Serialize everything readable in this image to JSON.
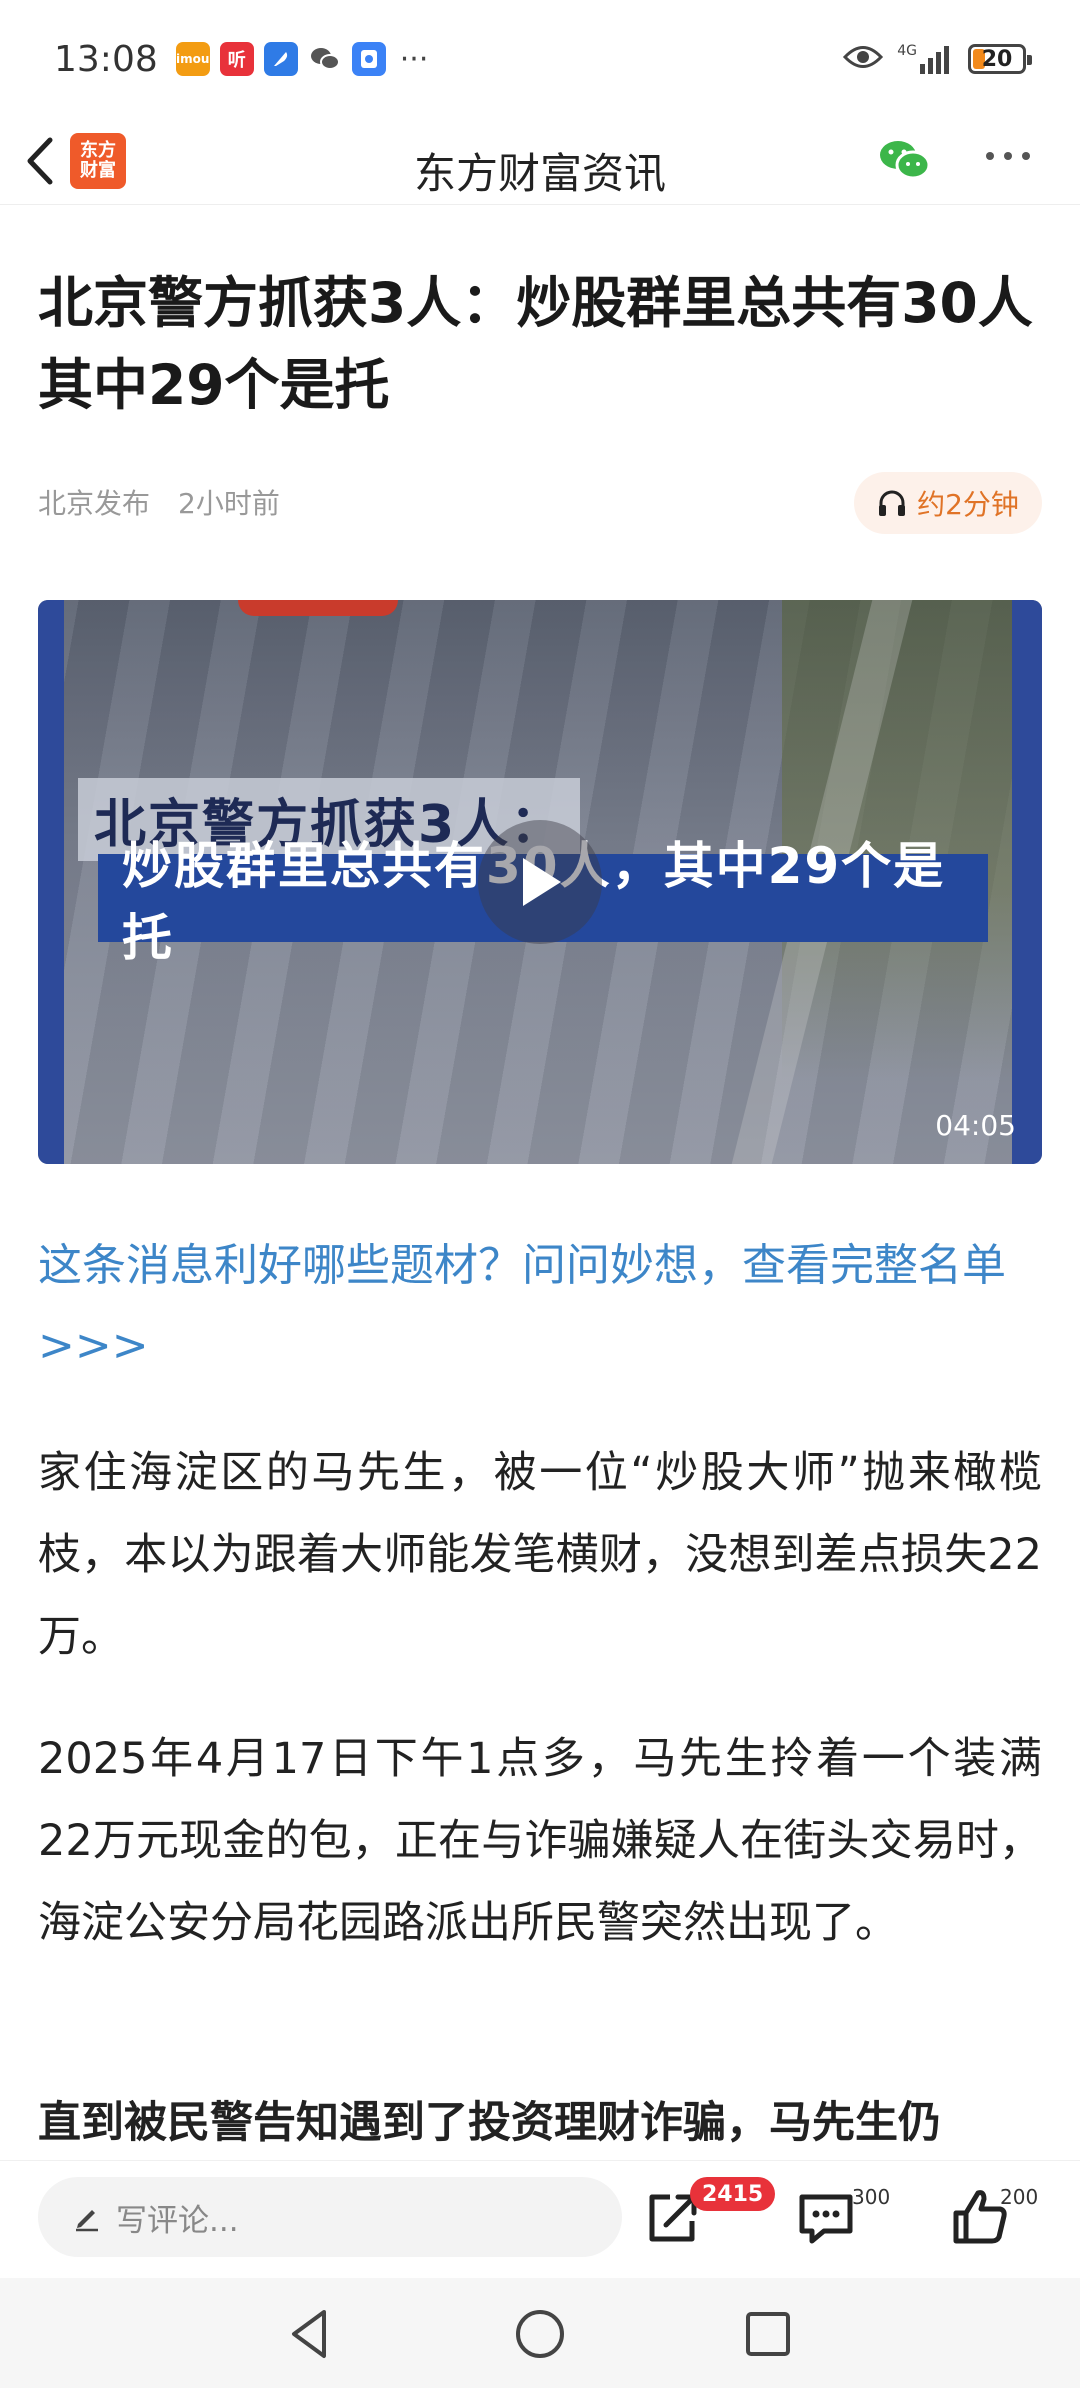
{
  "status_bar": {
    "time": "13:08",
    "app_icons": [
      {
        "name": "imou-app-icon",
        "label": "imou",
        "color": "#f39c12"
      },
      {
        "name": "ting-app-icon",
        "label": "听",
        "color": "#e8323a"
      },
      {
        "name": "feather-app-icon",
        "label": "",
        "color": "#2f7be6"
      },
      {
        "name": "wechat-app-icon",
        "label": "",
        "color": "#555555"
      },
      {
        "name": "shield-app-icon",
        "label": "",
        "color": "#3b82f6"
      }
    ],
    "more": "···",
    "network": "4G",
    "battery": "20"
  },
  "app_bar": {
    "logo_top": "东方",
    "logo_bottom": "财富",
    "title": "东方财富资讯"
  },
  "article": {
    "title": "北京警方抓获3人：炒股群里总共有30人 其中29个是托",
    "source": "北京发布",
    "time": "2小时前",
    "listen_label": "约2分钟",
    "video": {
      "caption_line1": "北京警方抓获3人：",
      "caption_line2": "炒股群里总共有30人，其中29个是托",
      "duration": "04:05"
    },
    "promo_link": "这条消息利好哪些题材？问问妙想，查看完整名单>>>",
    "paragraphs": [
      "家住海淀区的马先生，被一位“炒股大师”抛来橄榄枝，本以为跟着大师能发笔横财，没想到差点损失22万。",
      "2025年4月17日下午1点多，马先生拎着一个装满22万元现金的包，正在与诈骗嫌疑人在街头交易时，海淀公安分局花园路派出所民警突然出现了。",
      "直到被民警告知遇到了投资理财诈骗，马先生仍"
    ]
  },
  "action_bar": {
    "comment_placeholder": "写评论...",
    "share_badge": "2415",
    "comments_count": "300",
    "likes_count": "200"
  },
  "colors": {
    "brand": "#ef5a2a",
    "link": "#3d86c8",
    "badge": "#e8323a",
    "listen": "#e07326",
    "caption_band": "#24489c"
  }
}
